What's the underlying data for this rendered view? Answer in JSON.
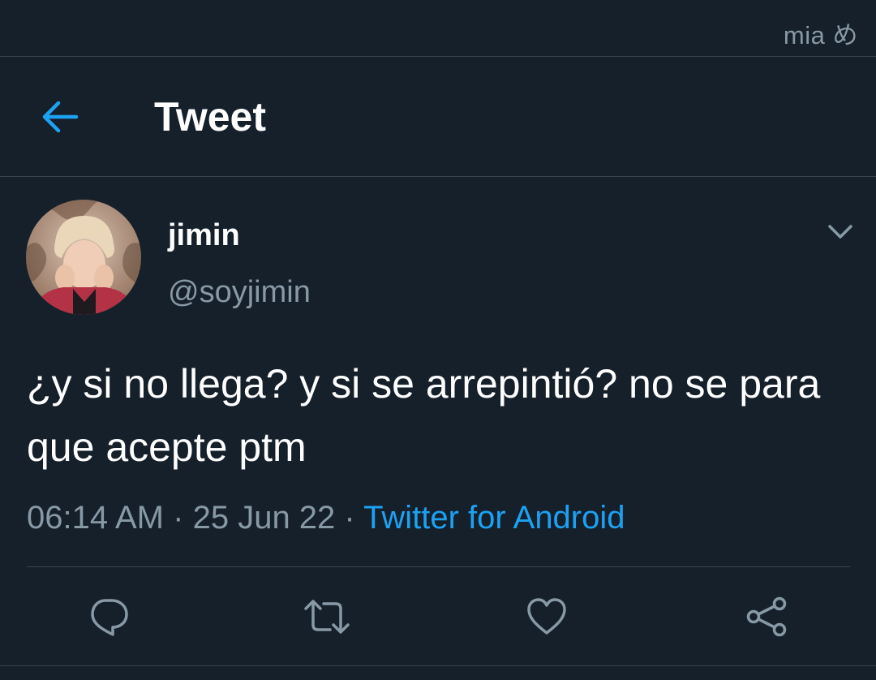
{
  "status_bar": {
    "watermark": "mia め"
  },
  "header": {
    "back_icon": "arrow-left-icon",
    "title": "Tweet"
  },
  "tweet": {
    "author": {
      "display_name": "jimin",
      "handle": "@soyjimin",
      "avatar": "profile-photo"
    },
    "menu_icon": "chevron-down-icon",
    "text": "¿y si no llega? y si se arrepintió? no se para que acepte ptm",
    "time": "06:14 AM",
    "date": "25 Jun 22",
    "separator": "·",
    "source": "Twitter for Android"
  },
  "actions": [
    {
      "name": "reply",
      "icon": "reply-icon"
    },
    {
      "name": "retweet",
      "icon": "retweet-icon"
    },
    {
      "name": "like",
      "icon": "heart-icon"
    },
    {
      "name": "share",
      "icon": "share-icon"
    }
  ],
  "colors": {
    "background": "#15202b",
    "divider": "#38444d",
    "secondary_text": "#8899a6",
    "accent": "#1da1f2",
    "primary_text": "#ffffff"
  }
}
